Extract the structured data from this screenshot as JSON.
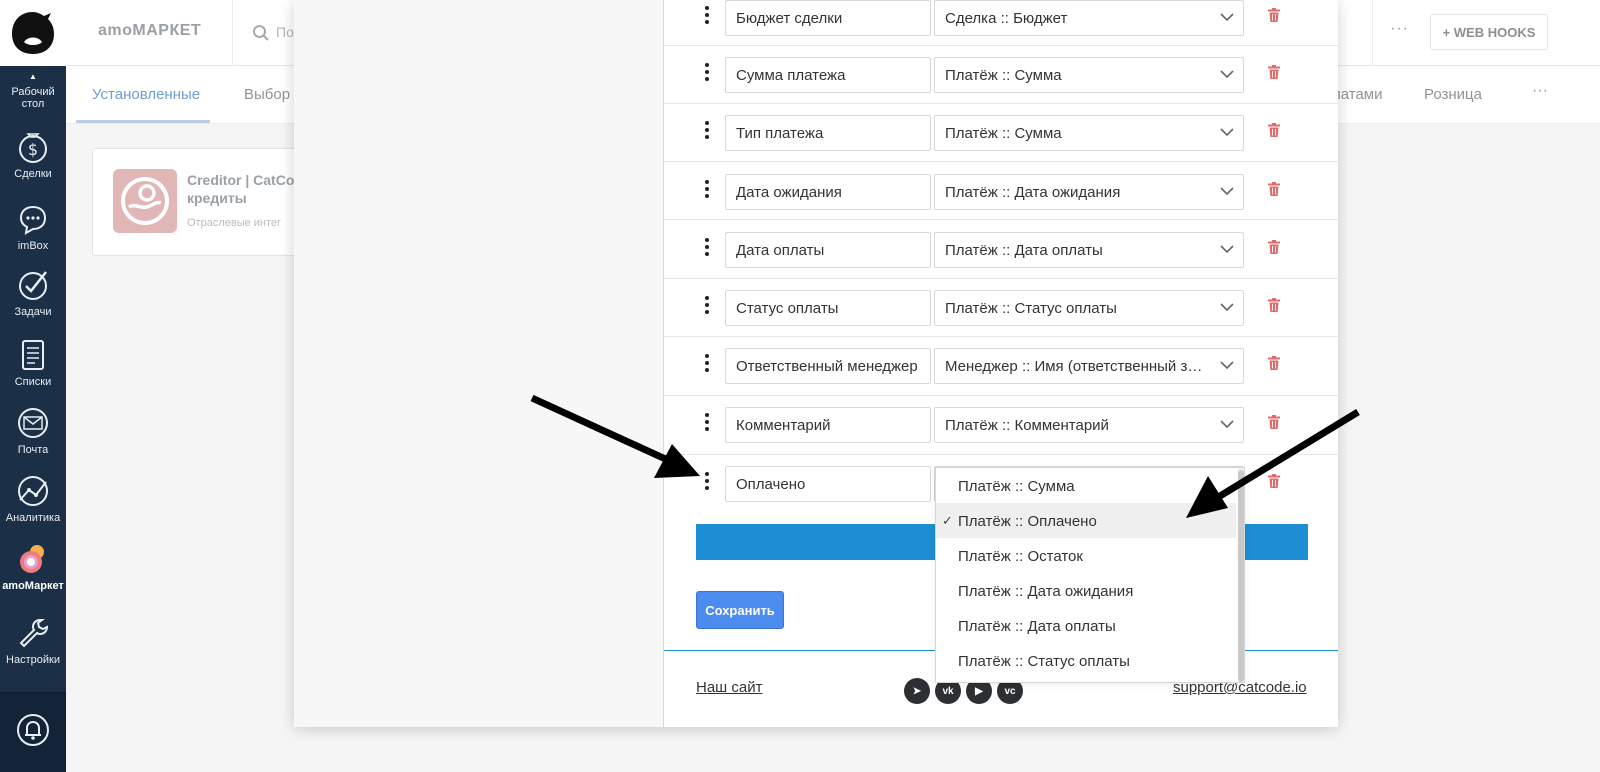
{
  "brand": {
    "name": "amoМАРКЕТ"
  },
  "search": {
    "placeholder": "По"
  },
  "header": {
    "more_label": "···",
    "webhooks_label": "+ WEB HOOKS"
  },
  "sidebar": {
    "items": [
      {
        "label": "Рабочий стол",
        "icon": "desktop-icon"
      },
      {
        "label": "Сделки",
        "icon": "dollar-icon"
      },
      {
        "label": "imBox",
        "icon": "chat-icon"
      },
      {
        "label": "Задачи",
        "icon": "check-circle-icon"
      },
      {
        "label": "Списки",
        "icon": "list-icon"
      },
      {
        "label": "Почта",
        "icon": "mail-icon"
      },
      {
        "label": "Аналитика",
        "icon": "analytics-icon"
      },
      {
        "label": "amoМаркет",
        "icon": "market-icon"
      },
      {
        "label": "Настройки",
        "icon": "wrench-icon"
      }
    ]
  },
  "tabs": [
    {
      "label": "Установленные"
    },
    {
      "label": "Выбор"
    },
    {
      "label": "латами"
    },
    {
      "label": "Розница"
    }
  ],
  "tabs_more": "···",
  "card": {
    "title_line1": "Creditor | CatCod",
    "title_line2": "кредиты",
    "subtitle": "Отраслевые интег"
  },
  "mapping_rows": [
    {
      "field": "Бюджет сделки",
      "value": "Сделка :: Бюджет"
    },
    {
      "field": "Сумма платежа",
      "value": "Платёж :: Сумма"
    },
    {
      "field": "Тип платежа",
      "value": "Платёж :: Сумма"
    },
    {
      "field": "Дата ожидания",
      "value": "Платёж :: Дата ожидания"
    },
    {
      "field": "Дата оплаты",
      "value": "Платёж :: Дата оплаты"
    },
    {
      "field": "Статус оплаты",
      "value": "Платёж :: Статус оплаты"
    },
    {
      "field": "Ответственный менеджер",
      "value": "Менеджер :: Имя (ответственный за сделку)"
    },
    {
      "field": "Комментарий",
      "value": "Платёж :: Комментарий"
    },
    {
      "field": "Оплачено",
      "value": ""
    }
  ],
  "dropdown": {
    "selected_index": 1,
    "options": [
      "Платёж :: Сумма",
      "Платёж :: Оплачено",
      "Платёж :: Остаток",
      "Платёж :: Дата ожидания",
      "Платёж :: Дата оплаты",
      "Платёж :: Статус оплаты"
    ],
    "check_mark": "✓"
  },
  "actions": {
    "save_label": "Сохранить"
  },
  "footer": {
    "site_link": "Наш сайт",
    "email": "support@catcode.io",
    "social": [
      {
        "name": "telegram-icon",
        "glyph": "➤"
      },
      {
        "name": "vk-icon",
        "glyph": "vk"
      },
      {
        "name": "youtube-icon",
        "glyph": "▶"
      },
      {
        "name": "vc-icon",
        "glyph": "vc"
      }
    ]
  },
  "colors": {
    "sidebar_bg": "#1b2f46",
    "accent_blue": "#1d8ed4",
    "save_button": "#4b8cee",
    "trash_red": "#e06b6b"
  }
}
